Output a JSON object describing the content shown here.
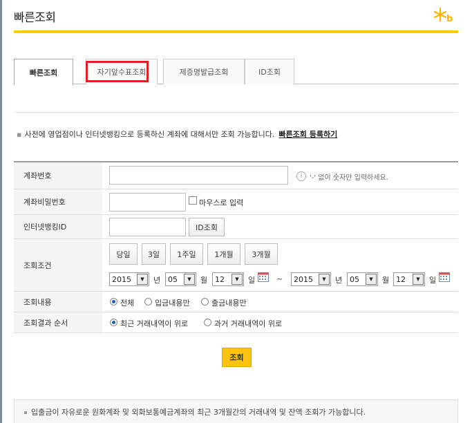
{
  "page": {
    "title": "빠른조회"
  },
  "tabs": [
    {
      "label": "빠른조회",
      "active": true
    },
    {
      "label": "자기앞수표조회",
      "active": false
    },
    {
      "label": "제증명발급조회",
      "active": false
    },
    {
      "label": "ID조회",
      "active": false
    }
  ],
  "notice": {
    "text": "사전에 영업점이나 인터넷뱅킹으로 등록하신 계좌에 대해서만 조회 가능합니다.",
    "link": "빠른조회 등록하기"
  },
  "form": {
    "account_number": {
      "label": "계좌번호",
      "value": "",
      "hint": "'-' 없이 숫자만 입력하세요."
    },
    "account_password": {
      "label": "계좌비밀번호",
      "value": "",
      "mouse_input_label": "마우스로 입력"
    },
    "internet_banking_id": {
      "label": "인터넷뱅킹ID",
      "value": "",
      "button_label": "ID조회"
    },
    "period": {
      "label": "조회조건",
      "quick_buttons": [
        "당일",
        "3일",
        "1주일",
        "1개월",
        "3개월"
      ],
      "from": {
        "year": "2015",
        "month": "05",
        "day": "12"
      },
      "to": {
        "year": "2015",
        "month": "05",
        "day": "12"
      },
      "units": {
        "year": "년",
        "month": "월",
        "day": "일"
      },
      "separator": "~"
    },
    "content": {
      "label": "조회내용",
      "options": [
        "전체",
        "입금내용만",
        "출금내용만"
      ],
      "selected": 0
    },
    "order": {
      "label": "조회결과 순서",
      "options": [
        "최근 거래내역이 위로",
        "과거 거래내역이 위로"
      ],
      "selected": 0
    },
    "submit_label": "조회"
  },
  "bottom_notice": "입출금이 자유로운 원화계좌 및 외화보통예금계좌의 최근 3개월간의 거래내역 및 잔액 조회가 가능합니다.",
  "colors": {
    "brand_yellow": "#ffcc00",
    "highlight_red": "#e01e25",
    "submit_bg": "#ffc20e"
  }
}
